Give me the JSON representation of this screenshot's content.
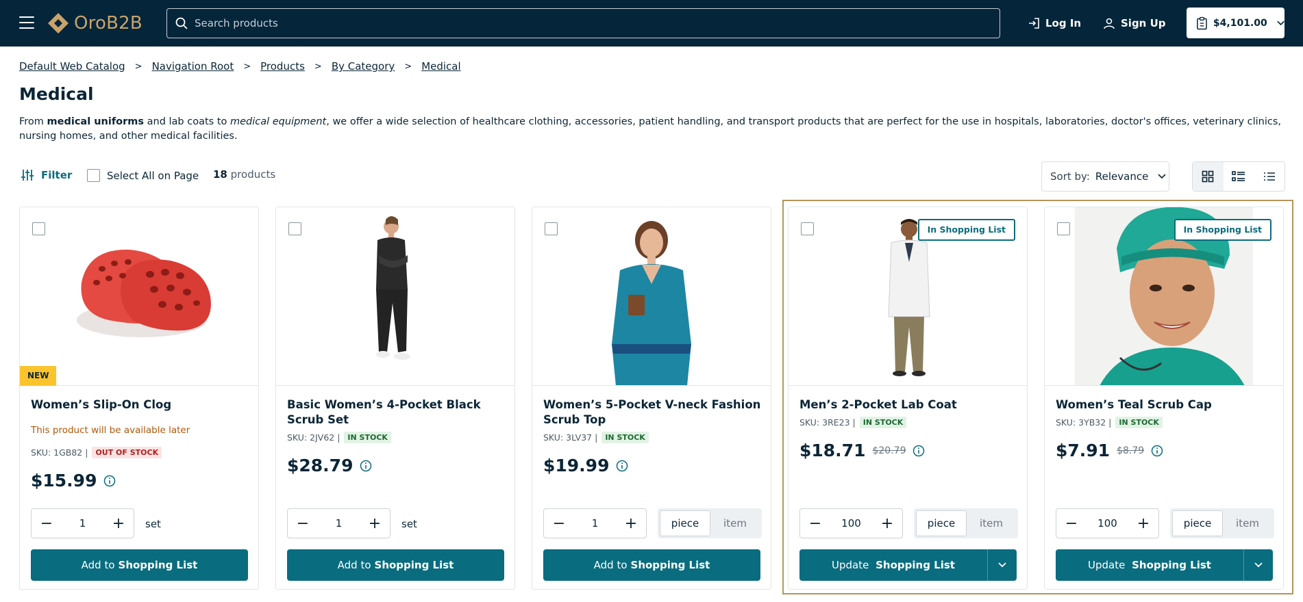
{
  "header": {
    "logo_text": "OroB2B",
    "search_placeholder": "Search products",
    "login_label": "Log In",
    "signup_label": "Sign Up",
    "cart_total": "$4,101.00"
  },
  "breadcrumbs": [
    "Default Web Catalog",
    "Navigation Root",
    "Products",
    "By Category",
    "Medical"
  ],
  "page": {
    "title": "Medical",
    "desc_1": "From ",
    "desc_2": "medical uniforms",
    "desc_3": " and lab coats to ",
    "desc_4": "medical equipment",
    "desc_5": ", we offer a wide selection of healthcare clothing, accessories, patient handling, and transport products that are perfect for the use in hospitals, laboratories, doctor's offices, veterinary clinics, nursing homes, and other medical facilities."
  },
  "toolbar": {
    "filter_label": "Filter",
    "select_all_label": "Select All on Page",
    "count_number": "18",
    "count_label": "products",
    "sort_prefix": "Sort by:",
    "sort_value": "Relevance"
  },
  "products": [
    {
      "name": "Women’s Slip-On Clog",
      "badge": "NEW",
      "availability_note": "This product will be available later",
      "sku": "SKU: 1GB82 |",
      "status": "OUT OF STOCK",
      "price": "$15.99",
      "qty": "1",
      "unit": "set",
      "button_prefix": "Add to",
      "button_bold": "Shopping List"
    },
    {
      "name": "Basic Women’s 4-Pocket Black Scrub Set",
      "sku": "SKU: 2JV62 |",
      "status": "IN STOCK",
      "price": "$28.79",
      "qty": "1",
      "unit": "set",
      "button_prefix": "Add to",
      "button_bold": "Shopping List"
    },
    {
      "name": "Women’s 5-Pocket V-neck Fashion Scrub Top",
      "sku": "SKU: 3LV37 |",
      "status": "IN STOCK",
      "price": "$19.99",
      "qty": "1",
      "unit_options": [
        "piece",
        "item"
      ],
      "button_prefix": "Add to",
      "button_bold": "Shopping List"
    },
    {
      "name": "Men’s 2-Pocket Lab Coat",
      "list_badge": "In Shopping List",
      "sku": "SKU: 3RE23 |",
      "status": "IN STOCK",
      "price": "$18.71",
      "old_price": "$20.79",
      "qty": "100",
      "unit_options": [
        "piece",
        "item"
      ],
      "button_prefix": "Update",
      "button_bold": "Shopping List"
    },
    {
      "name": "Women’s Teal Scrub Cap",
      "list_badge": "In Shopping List",
      "sku": "SKU: 3YB32 |",
      "status": "IN STOCK",
      "price": "$7.91",
      "old_price": "$8.79",
      "qty": "100",
      "unit_options": [
        "piece",
        "item"
      ],
      "button_prefix": "Update",
      "button_bold": "Shopping List"
    }
  ],
  "colors": {
    "header_bg": "#05253a",
    "primary": "#0a6c7f",
    "highlight": "#b4955b",
    "new_badge": "#fbc42d"
  }
}
